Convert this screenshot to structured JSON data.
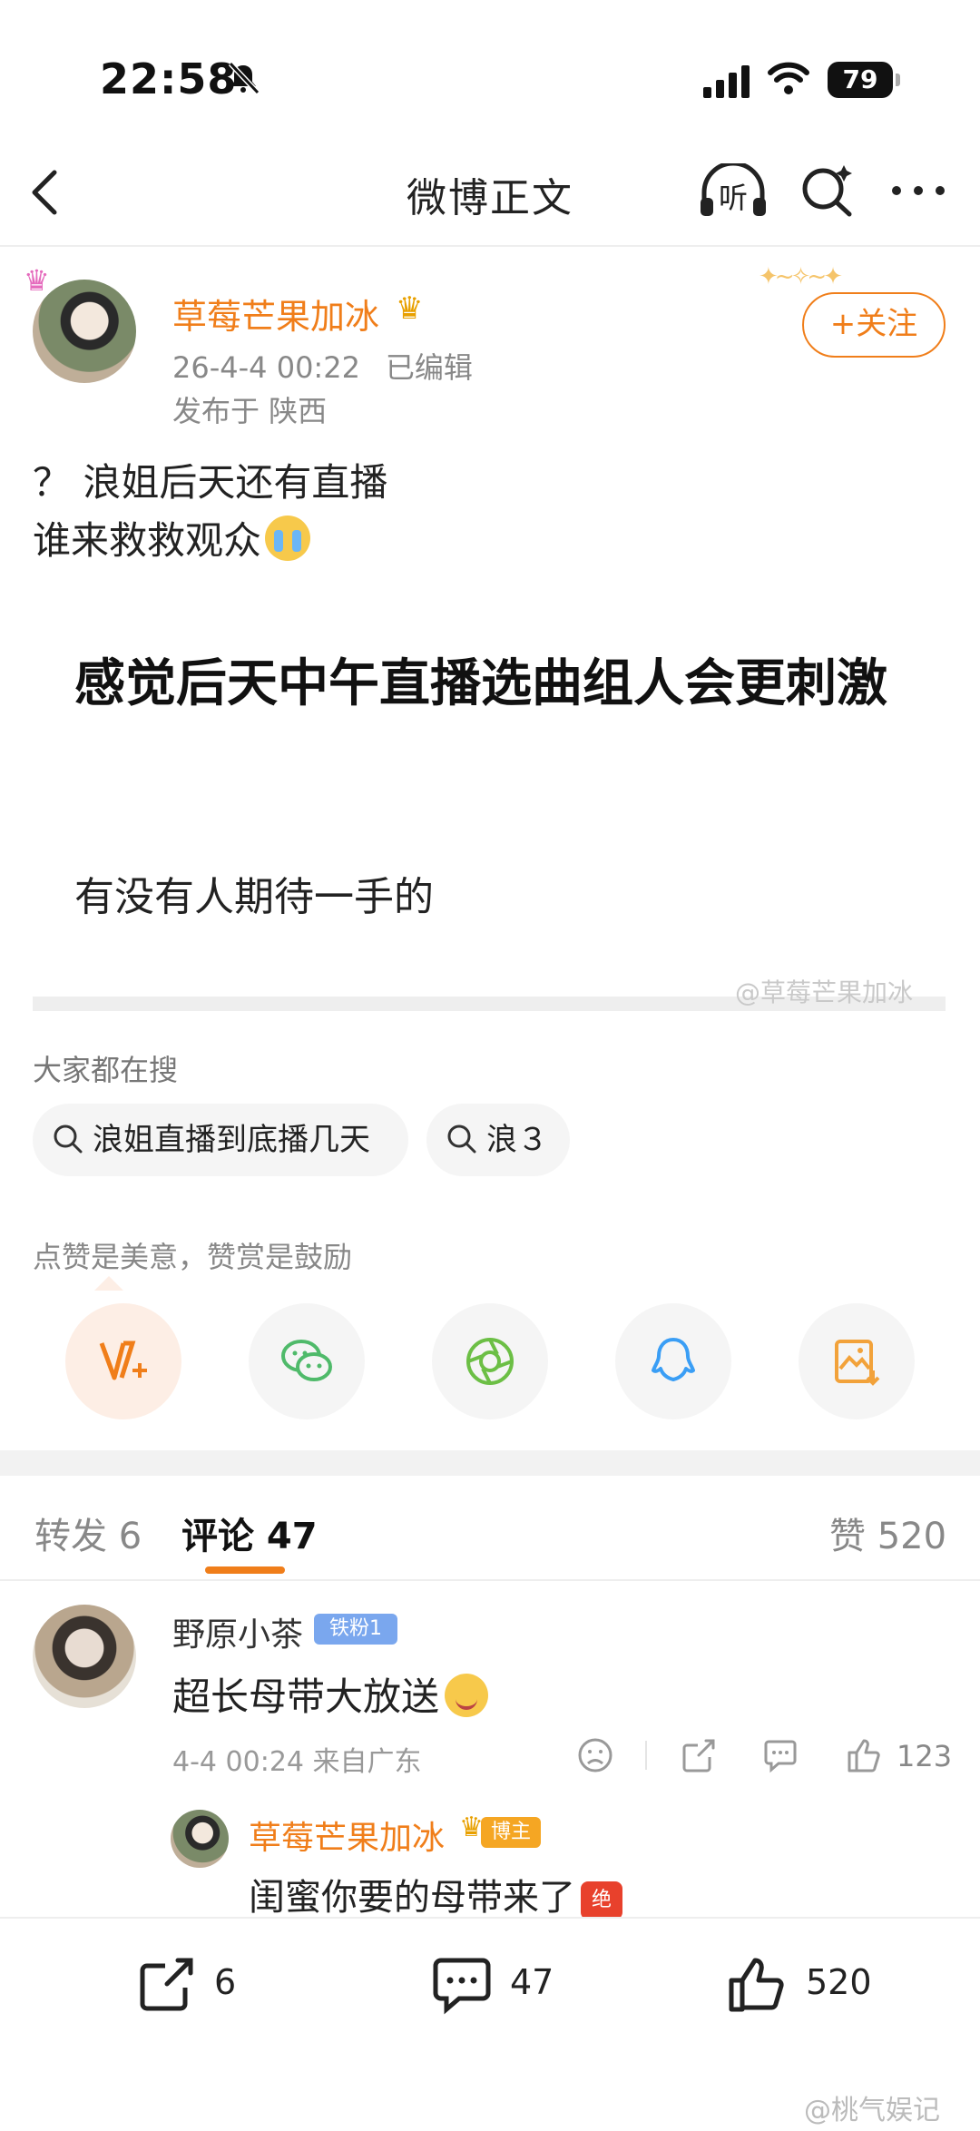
{
  "status_bar": {
    "time": "22:58",
    "battery": "79"
  },
  "header": {
    "title": "微博正文",
    "listen_label": "听"
  },
  "post": {
    "author": "草莓芒果加冰",
    "timestamp": "26-4-4 00:22",
    "edited": "已编辑",
    "location": "发布于 陕西",
    "follow_label": "+关注",
    "lines": [
      "？ 浪姐后天还有直播",
      "谁来救救观众"
    ],
    "card_title": "感觉后天中午直播选曲组人会更刺激",
    "card_sub": "有没有人期待一手的",
    "watermark": "@草莓芒果加冰"
  },
  "hot_search": {
    "label": "大家都在搜",
    "chips": [
      "浪姐直播到底播几天",
      "浪３"
    ]
  },
  "reward_label": "点赞是美意，赞赏是鼓励",
  "share_icons": [
    "reward-v-icon",
    "wechat-icon",
    "moments-icon",
    "qq-icon",
    "save-image-icon"
  ],
  "tabs": {
    "repost": "转发 6",
    "comment": "评论 47",
    "like": "赞 520"
  },
  "comment": {
    "name": "野原小茶",
    "fan_badge": "铁粉1",
    "text": "超长母带大放送",
    "meta": "4-4 00:24  来自广东",
    "likes": "123"
  },
  "reply": {
    "name": "草莓芒果加冰",
    "badge": "博主",
    "text": "闺蜜你要的母带来了",
    "emoji_label": "绝"
  },
  "bottom_bar": {
    "repost": "6",
    "comment": "47",
    "like": "520"
  },
  "bottom_watermark": "@桃气娱记",
  "colors": {
    "accent": "#f07e1a",
    "text": "#222222",
    "muted": "#888888"
  }
}
